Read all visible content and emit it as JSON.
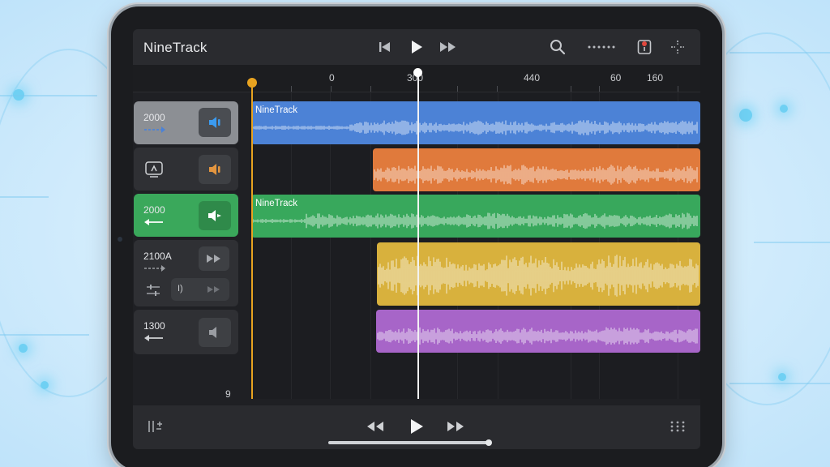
{
  "app": {
    "title": "NineTrack"
  },
  "ruler": {
    "labels": [
      "0",
      "300",
      "440",
      "60",
      "160"
    ]
  },
  "tracks": [
    {
      "name": "2000",
      "color": "#4c82d6",
      "selected": true
    },
    {
      "name": "",
      "color": "#e07a3c",
      "selected": false
    },
    {
      "name": "2000",
      "color": "#38a85c",
      "selected": true
    },
    {
      "name": "2100A",
      "color": "#d8b13d",
      "selected": false,
      "sub_control": "I)"
    },
    {
      "name": "1300",
      "color": "#a765c8",
      "selected": false
    }
  ],
  "clips": [
    {
      "label": "NineTrack",
      "color": "#4c82d6"
    },
    {
      "label": "",
      "color": "#e07a3c"
    },
    {
      "label": "NineTrack",
      "color": "#38a85c"
    },
    {
      "label": "",
      "color": "#d8b13d"
    },
    {
      "label": "",
      "color": "#a765c8"
    }
  ],
  "timeline": {
    "bottom_number": "9"
  },
  "icons": {
    "top": [
      "skip-back-icon",
      "play-icon",
      "fast-forward-icon",
      "search-icon",
      "more-dots-icon",
      "record-icon",
      "settings-icon"
    ],
    "bottom": [
      "mixer-icon",
      "rewind-icon",
      "play-icon",
      "fast-forward-icon",
      "grid-icon"
    ]
  },
  "colors": {
    "playhead": "#f2f2f2",
    "marker": "#e8a320",
    "background": "#1f2024"
  }
}
